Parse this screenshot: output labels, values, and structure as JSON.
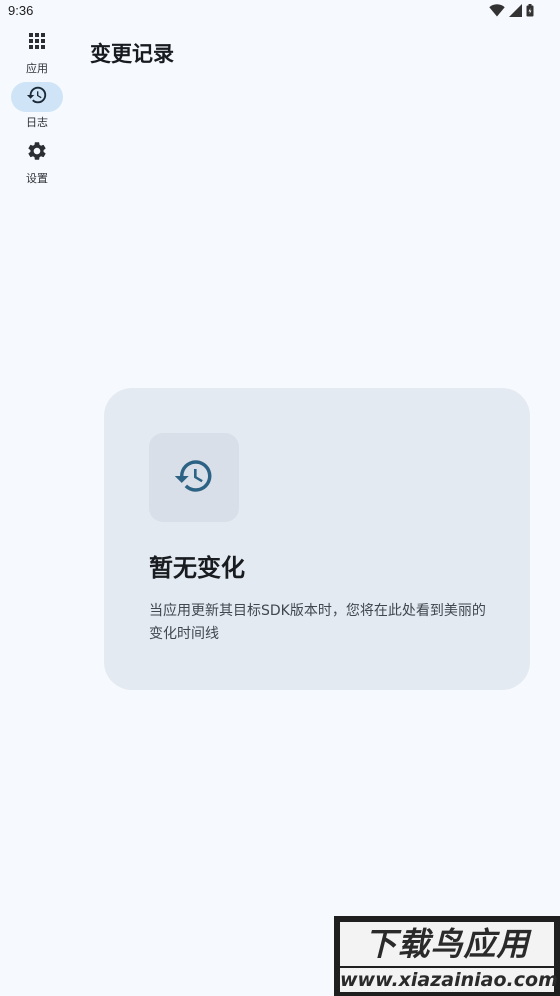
{
  "status_bar": {
    "time": "9:36",
    "icons": [
      "wifi-icon",
      "signal-icon",
      "battery-icon"
    ]
  },
  "nav": {
    "items": [
      {
        "label": "应用",
        "icon": "apps-grid-icon",
        "active": false
      },
      {
        "label": "日志",
        "icon": "history-icon",
        "active": true
      },
      {
        "label": "设置",
        "icon": "gear-icon",
        "active": false
      }
    ]
  },
  "page": {
    "title": "变更记录"
  },
  "empty_state": {
    "icon": "history-icon",
    "title": "暂无变化",
    "description": "当应用更新其目标SDK版本时，您将在此处看到美丽的变化时间线"
  },
  "watermark": {
    "main": "下载鸟应用",
    "sub": "www.xiazainiao.com"
  },
  "colors": {
    "background": "#f6f9fd",
    "active_pill": "#cfe5f7",
    "card": "#e4eaf2",
    "icon_box": "#d8dfe8",
    "accent_icon": "#2c6384"
  }
}
